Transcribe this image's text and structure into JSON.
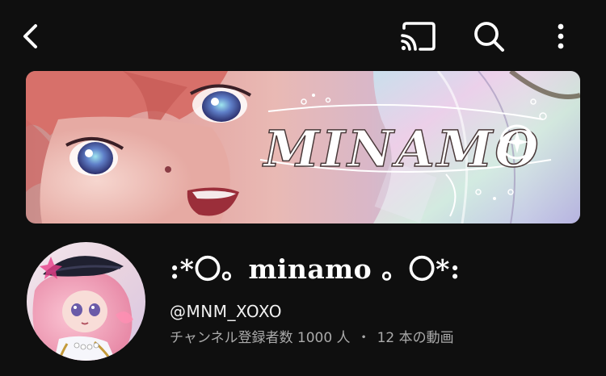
{
  "header": {
    "back_icon": "chevron-left-icon",
    "cast_icon": "cast-icon",
    "search_icon": "search-icon",
    "more_icon": "more-vertical-icon"
  },
  "banner": {
    "logo_text": "MINAMO"
  },
  "channel": {
    "name": ":*〇。minamo 。〇*:",
    "handle": "@MNM_XOXO",
    "subscribers": "チャンネル登録者数 1000 人",
    "separator": "・",
    "videos": "12 本の動画"
  },
  "colors": {
    "background": "#0f0f0f",
    "text_primary": "#ffffff",
    "text_secondary": "#aaaaaa"
  }
}
